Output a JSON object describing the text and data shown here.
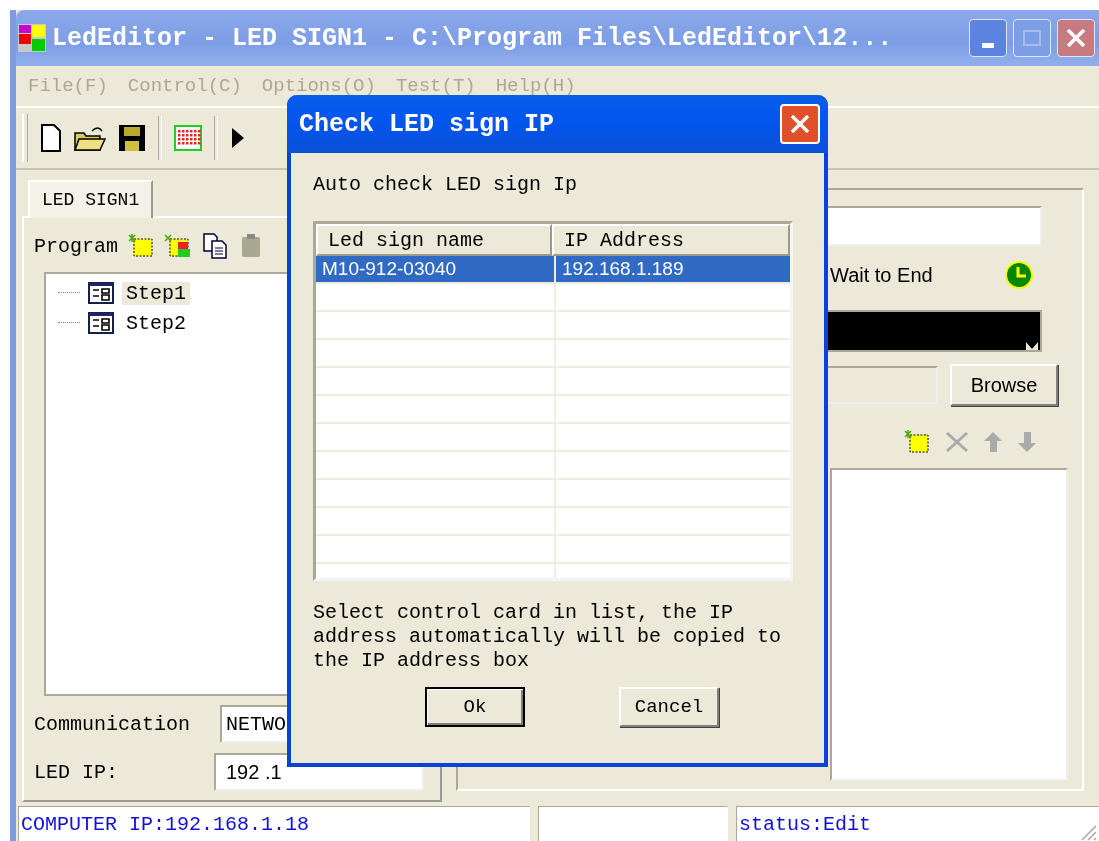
{
  "window": {
    "title": "LedEditor - LED SIGN1 - C:\\Program Files\\LedEditor\\12..."
  },
  "menu": [
    {
      "label": "File(F)",
      "disabled": true
    },
    {
      "label": "Control(C)",
      "disabled": true
    },
    {
      "label": "Options(O)",
      "disabled": true
    },
    {
      "label": "Test(T)",
      "disabled": true
    },
    {
      "label": "Help(H)",
      "disabled": true
    }
  ],
  "tabs": [
    {
      "label": "LED SIGN1",
      "selected": true
    }
  ],
  "program": {
    "label": "Program",
    "tree": [
      {
        "label": "Step1",
        "selected": true
      },
      {
        "label": "Step2",
        "selected": false
      }
    ]
  },
  "communication": {
    "label": "Communication",
    "value": "NETWO"
  },
  "led_ip": {
    "label": "LED IP:",
    "value": "192 .1"
  },
  "right_panel": {
    "wait_label": "Wait to End",
    "browse_button": "Browse"
  },
  "status_bar": {
    "computer_ip": "COMPUTER IP:192.168.1.18",
    "status": "status:Edit"
  },
  "dialog": {
    "title": "Check LED sign IP",
    "heading": "Auto check LED sign Ip",
    "columns": [
      "Led sign name",
      "IP Address"
    ],
    "rows": [
      {
        "cells": [
          "M10-912-03040",
          "192.168.1.189"
        ],
        "selected": true
      }
    ],
    "note": "Select control card in list, the IP address automatically will be copied to the IP address box",
    "buttons": [
      {
        "label": "Ok",
        "default": true
      },
      {
        "label": "Cancel",
        "default": false
      }
    ]
  }
}
